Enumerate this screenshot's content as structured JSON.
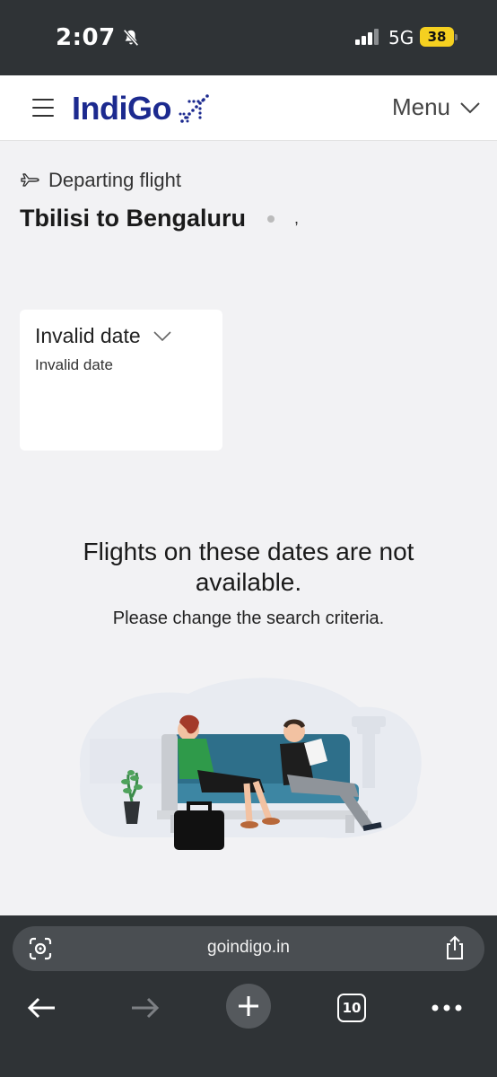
{
  "status_bar": {
    "time": "2:07",
    "network": "5G",
    "battery": "38"
  },
  "header": {
    "logo_text": "IndiGo",
    "menu_label": "Menu"
  },
  "main": {
    "departing_label": "Departing flight",
    "route": "Tbilisi to Bengaluru",
    "route_suffix": ",",
    "date_card": {
      "title": "Invalid date",
      "subtitle": "Invalid date"
    },
    "message_title": "Flights on these dates are not available.",
    "message_subtitle": "Please change the search criteria."
  },
  "browser": {
    "url": "goindigo.in",
    "tab_count": "10"
  },
  "colors": {
    "brand_blue": "#1c2a8f",
    "chrome_dark": "#2f3336"
  }
}
